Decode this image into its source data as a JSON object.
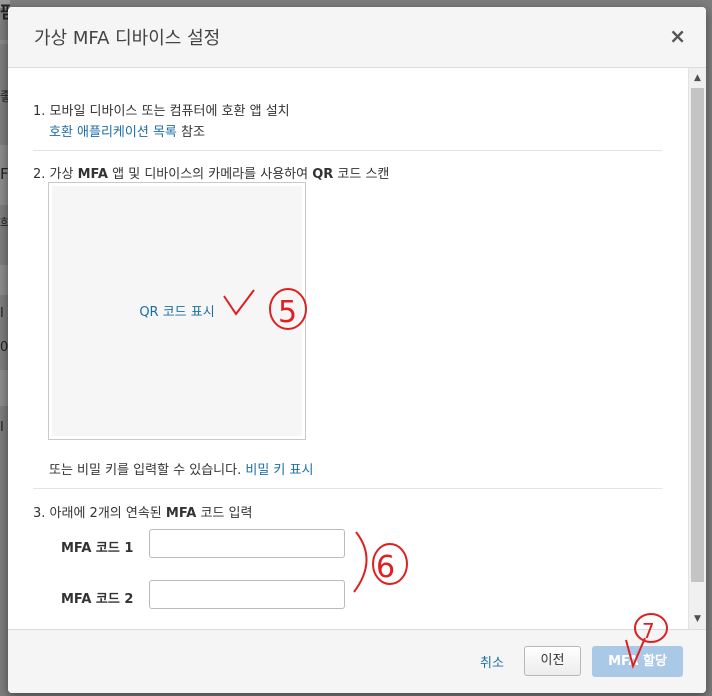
{
  "dialog": {
    "title": "가상 MFA 디바이스 설정",
    "close_glyph": "×"
  },
  "step1": {
    "text": "1. 모바일 디바이스 또는 컴퓨터에 호환 앱 설치",
    "link": "호환 애플리케이션 목록",
    "suffix": "참조"
  },
  "step2": {
    "prefix": "2. 가상",
    "bold1": "MFA",
    "middle": "앱 및 디바이스의 카메라를 사용하여",
    "bold2": "QR",
    "suffix": "코드 스캔",
    "qr_link": "QR 코드 표시",
    "secret_text": "또는 비밀 키를 입력할 수 있습니다.",
    "secret_link": "비밀 키 표시"
  },
  "step3": {
    "prefix": "3. 아래에 2개의 연속된",
    "bold": "MFA",
    "suffix": "코드 입력",
    "code1_label": "MFA 코드 1",
    "code2_label": "MFA 코드 2",
    "code1_value": "",
    "code2_value": ""
  },
  "footer": {
    "cancel": "취소",
    "previous": "이전",
    "assign": "MFA 할당"
  },
  "annotations": {
    "mark5": "5",
    "mark6": "6",
    "mark7": "7"
  },
  "scrollbar": {
    "up_glyph": "▲",
    "down_glyph": "▼"
  },
  "background": {
    "fragments": [
      "핃",
      "좋",
      "F",
      "희",
      "I",
      "0",
      "I"
    ]
  },
  "colors": {
    "link": "#1c6ea5",
    "primary_disabled": "#a9c9e7",
    "annotation": "#e02020"
  }
}
